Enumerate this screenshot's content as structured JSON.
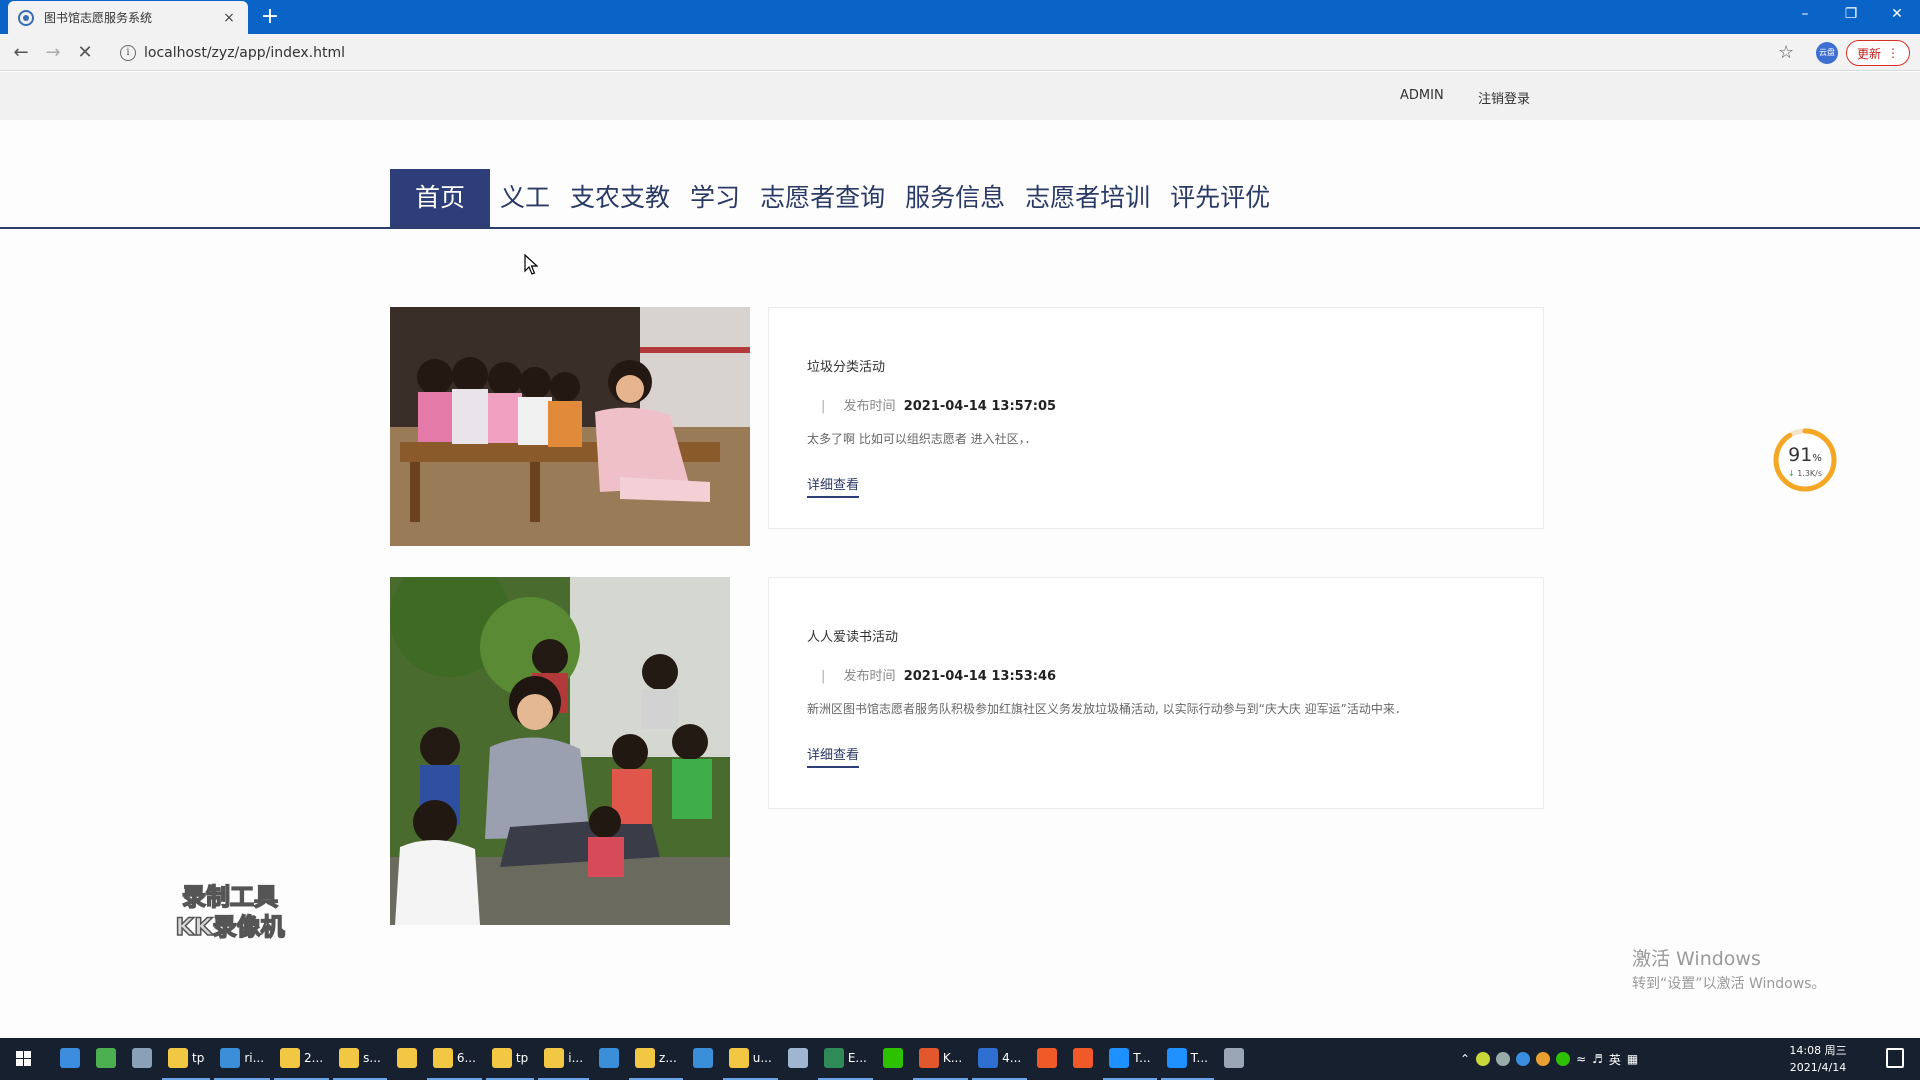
{
  "browser": {
    "tab_title": "图书馆志愿服务系统",
    "tab_close": "×",
    "new_tab": "+",
    "url": "localhost/zyz/app/index.html",
    "profile_label": "云盘",
    "update_label": "更新",
    "window_controls": [
      "–",
      "❐",
      "✕"
    ]
  },
  "topbar": {
    "user": "ADMIN",
    "logout": "注销登录"
  },
  "nav": {
    "items": [
      "首页",
      "义工",
      "支农支教",
      "学习",
      "志愿者查询",
      "服务信息",
      "志愿者培训",
      "评先评优"
    ],
    "active_index": 0
  },
  "posts": [
    {
      "title": "垃圾分类活动",
      "date_label": "发布时间",
      "date": "2021-04-14 13:57:05",
      "desc": "太多了啊 比如可以组织志愿者 进入社区，．",
      "more": "详细查看"
    },
    {
      "title": "人人爱读书活动",
      "date_label": "发布时间",
      "date": "2021-04-14 13:53:46",
      "desc": "新洲区图书馆志愿者服务队积极参加红旗社区义务发放垃圾桶活动, 以实际行动参与到“庆大庆 迎军运”活动中来．",
      "more": "详细查看"
    }
  ],
  "speed_widget": {
    "percent": "91",
    "percent_unit": "%",
    "rate": "1.3K/s",
    "level": 0.91,
    "color": "#f5a623"
  },
  "recorder_watermark": [
    "录制工具",
    "KK录像机"
  ],
  "activation": {
    "line1": "激活 Windows",
    "line2": "转到“设置”以激活 Windows。"
  },
  "taskbar": {
    "items": [
      {
        "label": "",
        "color": "#3c8de0"
      },
      {
        "label": "",
        "color": "#4caf50"
      },
      {
        "label": "",
        "color": "#8aa0b8"
      },
      {
        "label": "tp",
        "color": "#f2c744"
      },
      {
        "label": "ri...",
        "color": "#3b8fd9"
      },
      {
        "label": "2...",
        "color": "#f2c744"
      },
      {
        "label": "s...",
        "color": "#f2c744"
      },
      {
        "label": "",
        "color": "#f2c744"
      },
      {
        "label": "6...",
        "color": "#f2c744"
      },
      {
        "label": "tp",
        "color": "#f2c744"
      },
      {
        "label": "i...",
        "color": "#f2c744"
      },
      {
        "label": "",
        "color": "#3b8fd9"
      },
      {
        "label": "z...",
        "color": "#f2c744"
      },
      {
        "label": "",
        "color": "#3b8fd9"
      },
      {
        "label": "u...",
        "color": "#f2c744"
      },
      {
        "label": "",
        "color": "#9fb5d0"
      },
      {
        "label": "E...",
        "color": "#2e8b57"
      },
      {
        "label": "",
        "color": "#2dc100"
      },
      {
        "label": "K...",
        "color": "#e2572b"
      },
      {
        "label": "4...",
        "color": "#2f6fd1"
      },
      {
        "label": "",
        "color": "#f05a28"
      },
      {
        "label": "",
        "color": "#f05a28"
      },
      {
        "label": "T...",
        "color": "#1e90ff"
      },
      {
        "label": "T...",
        "color": "#1e90ff"
      },
      {
        "label": "",
        "color": "#9aa5b5"
      }
    ],
    "ime": "英",
    "time": "14:08 周三",
    "date": "2021/4/14"
  }
}
